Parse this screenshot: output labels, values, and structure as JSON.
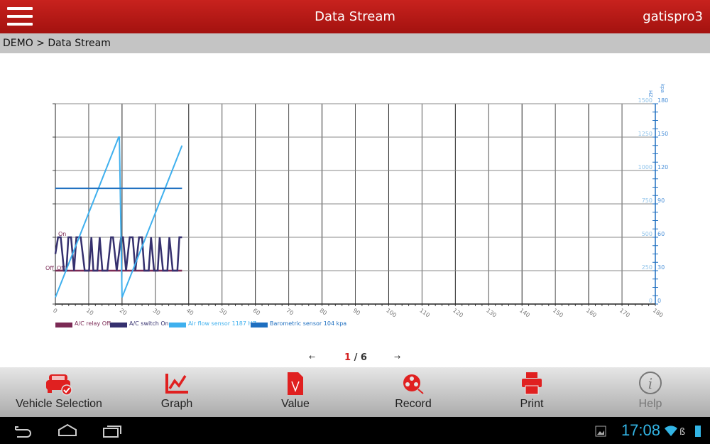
{
  "header": {
    "title": "Data Stream",
    "user": "gatispro3",
    "menu_icon": "hamburger-icon"
  },
  "breadcrumb": "DEMO > Data Stream",
  "chart_data": {
    "type": "line",
    "xlim": [
      0,
      180
    ],
    "x_ticks": [
      0,
      10,
      20,
      30,
      40,
      50,
      60,
      70,
      80,
      90,
      100,
      110,
      120,
      130,
      140,
      150,
      160,
      170,
      180
    ],
    "grid": true,
    "legend_placement": "bottom-left",
    "left_axis": {
      "labels": [
        "On",
        "Off"
      ]
    },
    "right_axis_hz": {
      "unit": "HZ",
      "ylim": [
        0,
        1500
      ],
      "ticks": [
        0,
        250,
        500,
        750,
        1000,
        1250,
        1500
      ]
    },
    "right_axis_kpa": {
      "unit": "kpa",
      "ylim": [
        0,
        180
      ],
      "ticks": [
        0,
        30,
        60,
        90,
        120,
        150,
        180
      ]
    },
    "series": [
      {
        "name": "A/C relay Off",
        "color": "#7b2a55",
        "axis": "state",
        "x": [
          0,
          38
        ],
        "y": [
          0,
          0
        ]
      },
      {
        "name": "A/C switch On",
        "color": "#35306e",
        "axis": "state",
        "x": [
          0,
          0.8,
          1.6,
          2.6,
          3.3,
          3.9,
          4.7,
          5.6,
          6.3,
          7.6,
          8.8,
          10.1,
          10.8,
          11.4,
          12.6,
          13.3,
          14.1,
          15.6,
          16.7,
          17.3,
          18.4,
          19.7,
          20.3,
          21.2,
          22.3,
          23.2,
          24.0,
          25.1,
          26.0,
          26.7,
          28.0,
          28.7,
          29.6,
          30.7,
          31.3,
          32.3,
          33.6,
          34.2,
          35.2,
          36.6,
          37.2,
          38
        ],
        "y": [
          0.5,
          1,
          1,
          0,
          0,
          1,
          1,
          0,
          1,
          1,
          0,
          0,
          1,
          0,
          0,
          1,
          0,
          0,
          1,
          1,
          0,
          1,
          1,
          0,
          1,
          1,
          0,
          1,
          1,
          0,
          0,
          1,
          0,
          0,
          1,
          0,
          0,
          1,
          0,
          0,
          1,
          1
        ]
      },
      {
        "name": "Air flow sensor 1187 HZ",
        "color": "#3fb0ee",
        "axis": "hz",
        "x": [
          0,
          19,
          19.2,
          20,
          38
        ],
        "y": [
          50,
          1250,
          1250,
          50,
          1187
        ]
      },
      {
        "name": "Barometric sensor 104 kpa",
        "color": "#1e6fc0",
        "axis": "kpa",
        "x": [
          0,
          38
        ],
        "y": [
          104,
          104
        ]
      }
    ]
  },
  "pager": {
    "prev": "←",
    "current": "1",
    "total": "/ 6",
    "next": "→"
  },
  "toolbar": [
    {
      "label": "Vehicle Selection",
      "icon": "car-check-icon"
    },
    {
      "label": "Graph",
      "icon": "graph-icon"
    },
    {
      "label": "Value",
      "icon": "value-document-icon"
    },
    {
      "label": "Record",
      "icon": "record-reel-icon"
    },
    {
      "label": "Print",
      "icon": "printer-icon"
    },
    {
      "label": "Help",
      "icon": "info-icon"
    }
  ],
  "status": {
    "time": "17:08"
  }
}
